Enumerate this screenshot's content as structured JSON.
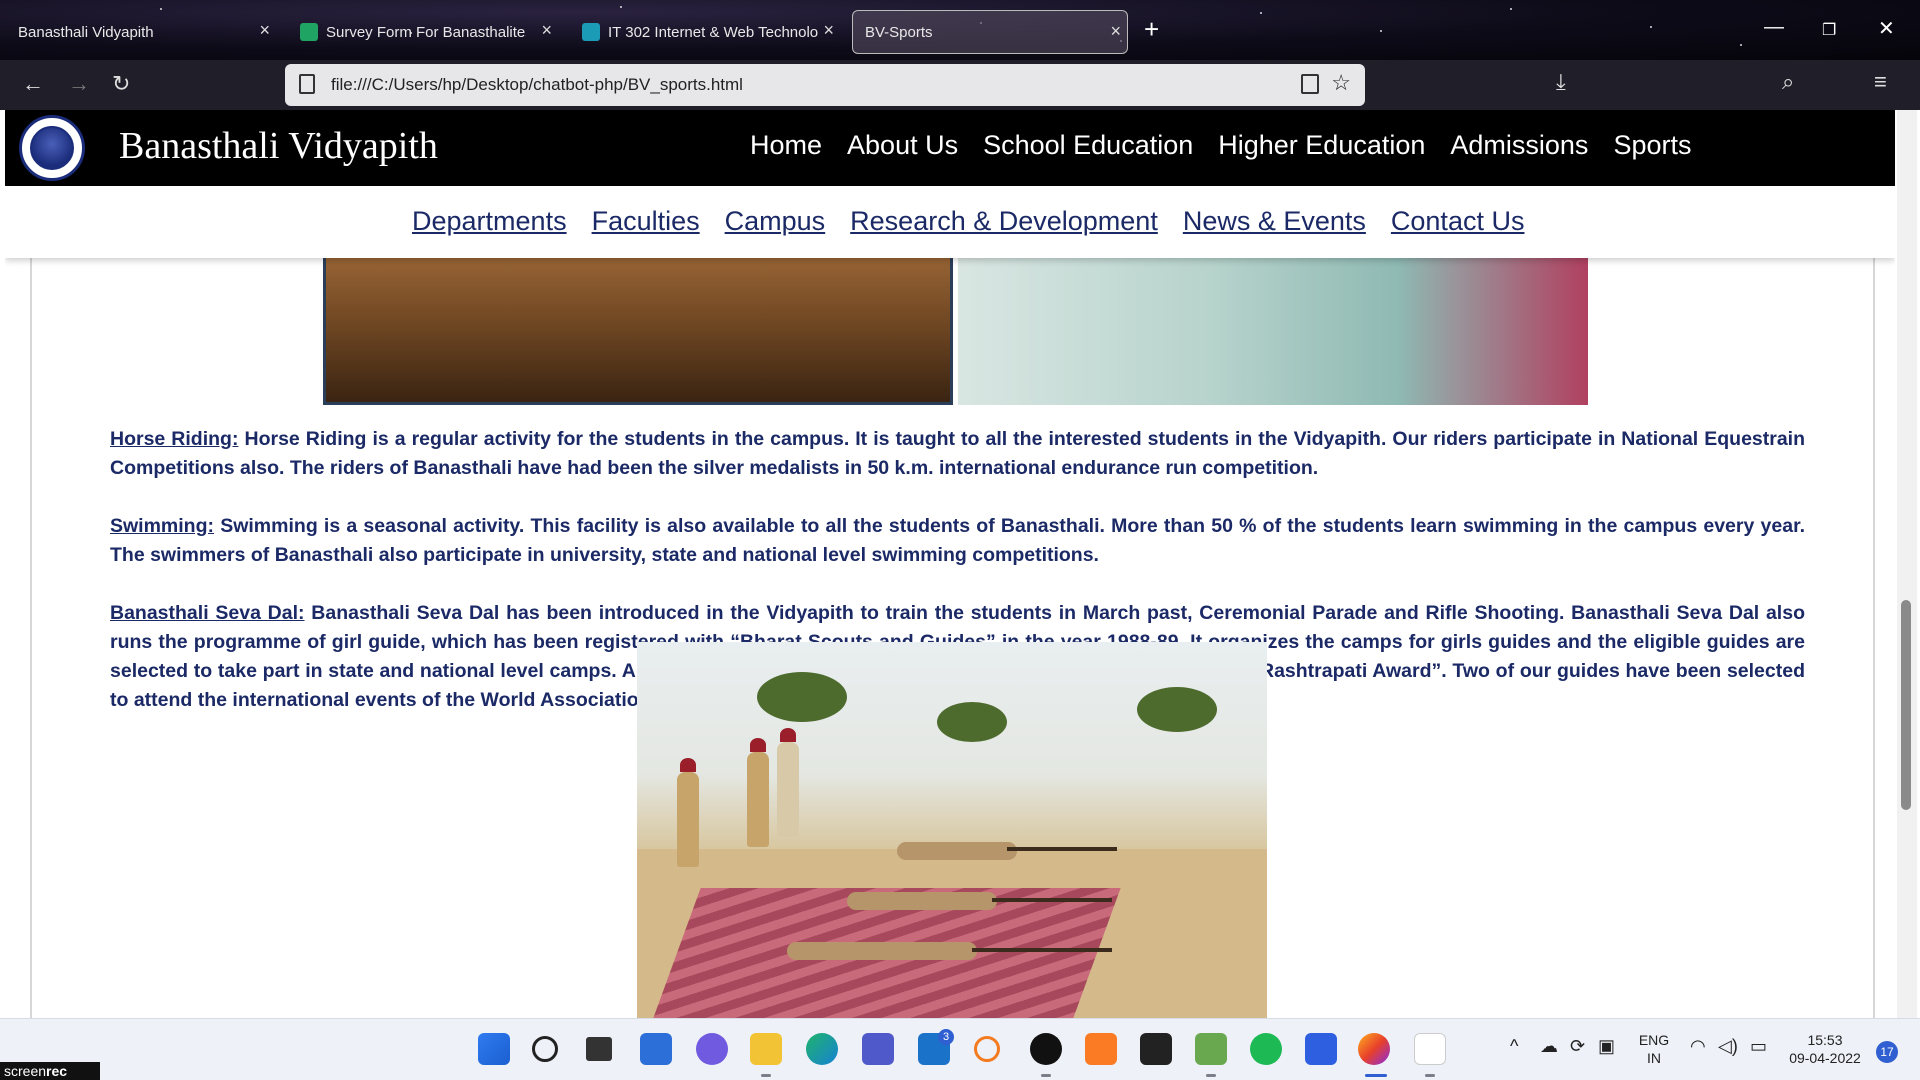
{
  "browser": {
    "tabs": [
      {
        "title": "Banasthali Vidyapith",
        "active": false,
        "icon": "none"
      },
      {
        "title": "Survey Form For Banasthalites (",
        "active": false,
        "icon": "sheets-icon"
      },
      {
        "title": "IT 302 Internet & Web Technolo",
        "active": false,
        "icon": "classroom-icon"
      },
      {
        "title": "BV-Sports",
        "active": true,
        "icon": "none"
      }
    ],
    "new_tab_label": "+",
    "url": "file:///C:/Users/hp/Desktop/chatbot-php/BV_sports.html"
  },
  "site": {
    "title": "Banasthali Vidyapith",
    "main_nav": [
      "Home",
      "About Us",
      "School Education",
      "Higher Education",
      "Admissions",
      "Sports"
    ],
    "sub_nav": [
      "Departments",
      "Faculties",
      "Campus",
      "Research & Development",
      "News & Events",
      "Contact Us"
    ],
    "sections": [
      {
        "label": "Horse Riding:",
        "text": "Horse Riding is a regular activity for the students in the campus. It is taught to all the interested students in the Vidyapith. Our riders participate in National Equestrain Competitions also. The riders of Banasthali have had been the silver medalists in 50 k.m. international endurance run competition."
      },
      {
        "label": "Swimming:",
        "text": "Swimming is a seasonal activity. This facility is also available to all the students of Banasthali. More than 50 % of the students learn swimming in the campus every year. The swimmers of Banasthali also participate in university, state and national level swimming competitions."
      },
      {
        "label": "Banasthali Seva Dal:",
        "text": "Banasthali Seva Dal has been introduced in the Vidyapith to train the students in March past, Ceremonial Parade and Rifle Shooting. Banasthali Seva Dal also runs the programme of girl guide, which has been registered with “Bharat Scouts and Guides” in the year 1988-89. It organizes the camps for girls guides and the eligible guides are selected to take part in state and national level camps. A Number of students from the Vidyapith have been honoured with “Rashtrapati Award”. Two of our guides have been selected to attend the international events of the World Association of Girl Guides and Girl Scouts at Pune (WAGGGS)."
      }
    ]
  },
  "taskbar": {
    "mail_badge": "3",
    "lang": "ENG",
    "region": "IN",
    "time": "15:53",
    "date": "09-04-2022",
    "notification_count": "17"
  },
  "watermark": {
    "prefix": "screen",
    "suffix": "rec"
  },
  "colors": {
    "link": "#1b2a66",
    "header_bg": "#000000"
  }
}
